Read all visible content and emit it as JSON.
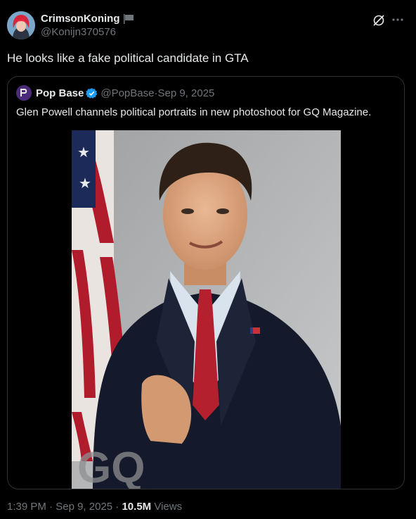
{
  "author": {
    "display_name": "CrimsonKoning",
    "handle": "@Konijn370576"
  },
  "tweet": {
    "text": "He looks like a fake political candidate in GTA"
  },
  "quoted": {
    "name": "Pop Base",
    "handle": "@PopBase",
    "separator": " · ",
    "date": "Sep 9, 2025",
    "text": "Glen Powell channels political portraits in new photoshoot for GQ Magazine.",
    "image_watermark": "GQ"
  },
  "meta": {
    "time": "1:39 PM",
    "separator": " · ",
    "date": "Sep 9, 2025",
    "views_count": "10.5M",
    "views_label": "Views"
  },
  "icons": {
    "grok": "grok-icon",
    "more": "more-icon",
    "verified": "verified-icon",
    "flag": "flag-icon"
  }
}
